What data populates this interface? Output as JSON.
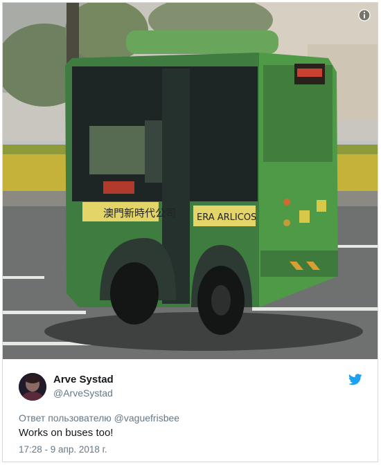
{
  "media": {
    "bus_sign_chinese": "澳門新時代公司",
    "bus_sign_latin": "ERA ARLICOS",
    "info_icon": "info-icon"
  },
  "tweet": {
    "display_name": "Arve Systad",
    "handle": "@ArveSystad",
    "reply_prefix": "Ответ пользователю",
    "reply_to_handle": "@vaguefrisbee",
    "text": "Works on buses too!",
    "timestamp": "17:28 - 9 апр. 2018 г.",
    "platform_icon": "twitter-bird-icon",
    "brand_color": "#1da1f2"
  }
}
